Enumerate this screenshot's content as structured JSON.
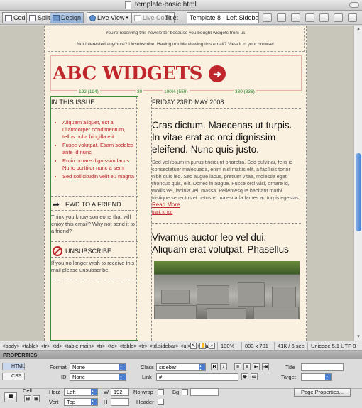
{
  "window": {
    "title": "template-basic.html"
  },
  "toolbar": {
    "code": "Code",
    "split": "Split",
    "design": "Design",
    "live_view": "Live View",
    "live_code": "Live Code",
    "title_label": "Title:",
    "title_value": "Template 8 - Left Sidebar"
  },
  "email": {
    "notice1": "You're receiving this newsletter because you bought widgets from us.",
    "notice2": "Not interested anymore? Unsubscribe. Having trouble viewing this email? View it in your browser.",
    "logo": "ABC WIDGETS",
    "logo_arrow": "➜",
    "widths": {
      "left": "192 (194)",
      "gutter": "30",
      "total": "100% (559)",
      "right": "330 (336)"
    },
    "sidebar": {
      "heading": "IN THIS ISSUE",
      "links": [
        "Aliquam aliquet, est a ullamcorper condimentum, tellus nulla fringilla elit",
        "Fusce volutpat. Etiam sodales ante id nunc",
        "Proin ornare dignissim lacus. Nunc porttitor nunc a sem",
        "Sed sollicitudin velit eu magna"
      ],
      "fwd_heading": "FWD TO A FRIEND",
      "fwd_text": "Think you know someone that will enjoy this email? Why not send it to a friend?",
      "unsub_heading": "UNSUBSCRIBE",
      "unsub_text": "If you no longer wish to receive this mail please unsubscribe."
    },
    "main": {
      "date": "FRIDAY 23RD MAY 2008",
      "headline1": "Cras dictum. Maecenas ut turpis. In vitae erat ac orci dignissim eleifend. Nunc quis justo.",
      "body": "Sed vel ipsum in purus tincidunt pharetra. Sed pulvinar, felis id consectetuer malesuada, enim nisl mattis elit, a facilisis tortor nibh quis leo. Sed augue lacus, pretium vitae, molestie eget, rhoncus quis, elit. Donec in augue. Fusce orci wisi, ornare id, mollis vel, lacinia vel, massa. Pellentesque habitant morbi tristique senectus et netus et malesuada fames ac turpis egestas.",
      "read_more": "Read More",
      "back_to_top": "back to top",
      "headline2": "Vivamus auctor leo vel dui. Aliquam erat volutpat. Phasellus"
    }
  },
  "statusbar": {
    "tags_prefix": "<body> <table> <tr> <td> <table.main> <tr> <td> <table> <tr> <td.sidebar> <ul> <li>",
    "tags_selected": "<a>",
    "zoom": "100%",
    "size": "803 x 701",
    "weight": "41K / 6 sec",
    "encoding": "Unicode 5.1 UTF-8"
  },
  "properties": {
    "header": "PROPERTIES",
    "mode_html": "HTML",
    "mode_css": "CSS",
    "format_label": "Format",
    "format_value": "None",
    "id_label": "ID",
    "id_value": "None",
    "class_label": "Class",
    "class_value": "sidebar",
    "link_label": "Link",
    "link_value": "#",
    "title_label": "Title",
    "target_label": "Target",
    "bold": "B",
    "italic": "I",
    "cell_label": "Cell",
    "horz_label": "Horz",
    "horz_value": "Left",
    "vert_label": "Vert",
    "vert_value": "Top",
    "w_label": "W",
    "w_value": "192",
    "h_label": "H",
    "nowrap_label": "No wrap",
    "header_label": "Header",
    "bg_label": "Bg",
    "page_props": "Page Properties..."
  },
  "colors": {
    "brand_red": "#c0272d",
    "page_bg": "#faf1e1",
    "canvas": "#c8c6bb",
    "accent_blue": "#4a7ed0"
  }
}
